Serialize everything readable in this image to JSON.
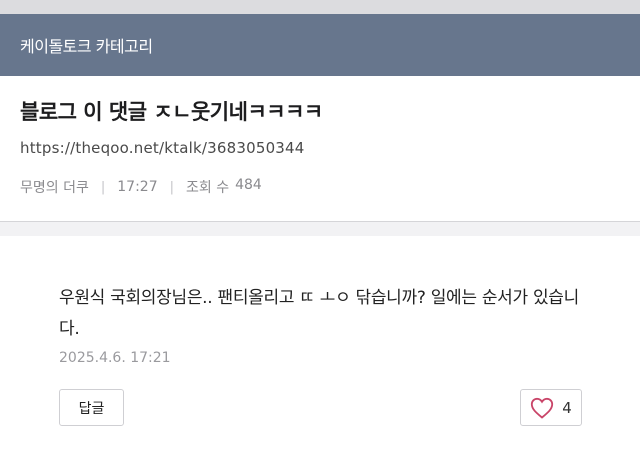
{
  "category": {
    "title": "케이돌토크 카테고리"
  },
  "post": {
    "title": "블로그 이 댓글 ㅈㄴ웃기네ㅋㅋㅋㅋ",
    "url": "https://theqoo.net/ktalk/3683050344",
    "author": "무명의 더쿠",
    "time": "17:27",
    "views_label": "조회 수",
    "views": "484"
  },
  "comment": {
    "body": "우원식 국회의장님은.. 팬티올리고 ㄸ ㅗㅇ 닦습니까? 일에는 순서가 있습니다.",
    "date": "2025.4.6. 17:21",
    "reply_label": "답글",
    "like_count": "4"
  },
  "colors": {
    "category_bar": "#67768d",
    "heart": "#c94468"
  }
}
